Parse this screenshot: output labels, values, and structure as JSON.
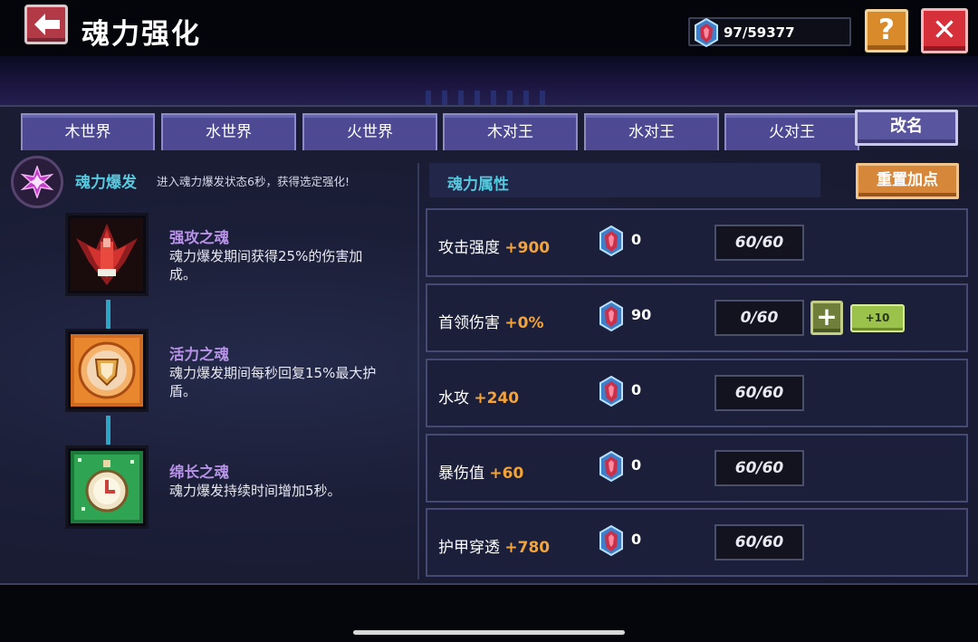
{
  "header": {
    "title": "魂力强化",
    "currency": "97/59377"
  },
  "tabs": [
    "木世界",
    "水世界",
    "火世界",
    "木对王",
    "水对王",
    "火对王"
  ],
  "rename_button": "改名",
  "soul_burst": {
    "label": "魂力爆发",
    "description": "进入魂力爆发状态6秒，获得选定强化!"
  },
  "skills": [
    {
      "name": "强攻之魂",
      "desc_line1": "魂力爆发期间获得25%的伤害加",
      "desc_line2": "成。",
      "icon": "red-winged-attack-icon"
    },
    {
      "name": "活力之魂",
      "desc_line1": "魂力爆发期间每秒回复15%最大护",
      "desc_line2": "盾。",
      "icon": "orange-shield-icon"
    },
    {
      "name": "绵长之魂",
      "desc_line1": "魂力爆发持续时间增加5秒。",
      "desc_line2": "",
      "icon": "green-stopwatch-icon"
    }
  ],
  "attributes": {
    "header": "魂力属性",
    "reset_button": "重置加点",
    "rows": [
      {
        "name": "攻击强度",
        "bonus": "+900",
        "cost": "0",
        "level": "60/60"
      },
      {
        "name": "首领伤害",
        "bonus": "+0%",
        "cost": "90",
        "level": "0/60",
        "plus": "+",
        "plus10": "+10"
      },
      {
        "name": "水攻",
        "bonus": "+240",
        "cost": "0",
        "level": "60/60"
      },
      {
        "name": "暴伤值",
        "bonus": "+60",
        "cost": "0",
        "level": "60/60"
      },
      {
        "name": "护甲穿透",
        "bonus": "+780",
        "cost": "0",
        "level": "60/60"
      }
    ]
  },
  "colors": {
    "accent_cyan": "#57c9de",
    "bonus_orange": "#f2a33a",
    "skill_purple": "#b792e8",
    "tab_purple": "#4d4a93"
  }
}
